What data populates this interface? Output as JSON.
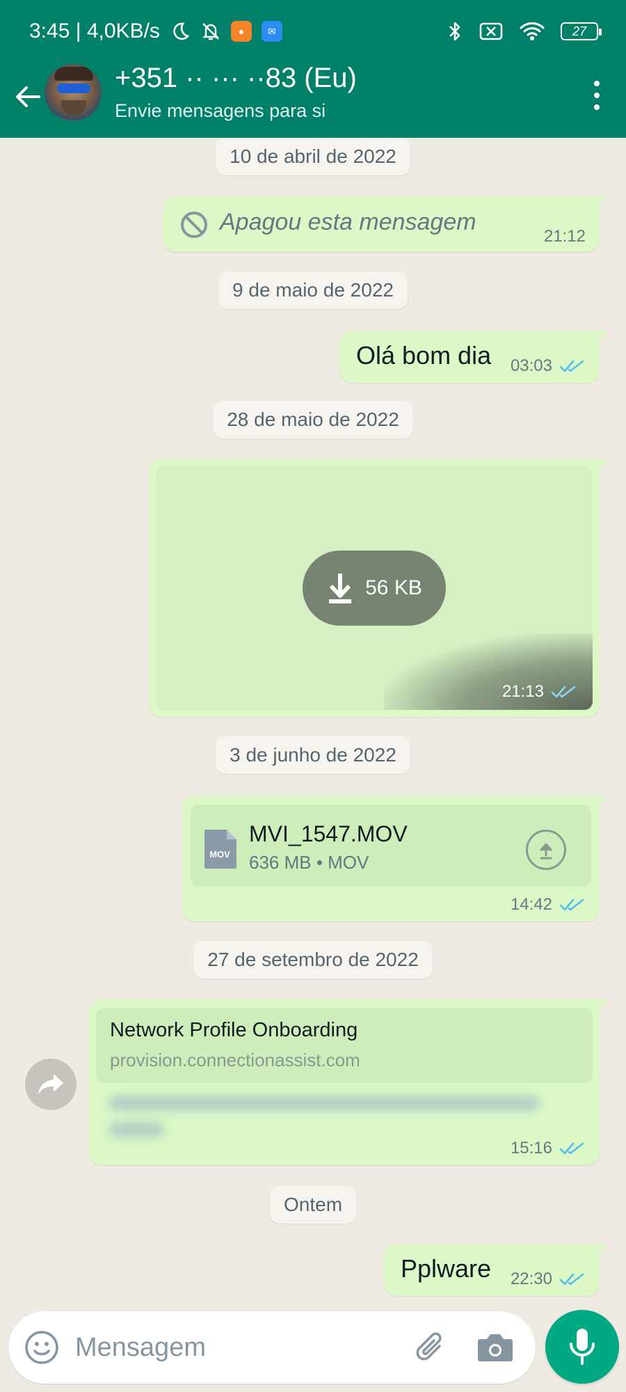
{
  "status_bar": {
    "time_speed": "3:45 | 4,0KB/s",
    "battery": "27",
    "app_badge_1_color": "#f5842b",
    "app_badge_2_color": "#2d8cf0"
  },
  "header": {
    "contact_name": "+351 ·· ··· ··83 (Eu)",
    "subtitle": "Envie mensagens para si",
    "brand_color": "#008069"
  },
  "messages": [
    {
      "type": "date",
      "label": "10 de abril de 2022"
    },
    {
      "type": "deleted",
      "text": "Apagou esta mensagem",
      "time": "21:12"
    },
    {
      "type": "date",
      "label": "9 de maio de 2022"
    },
    {
      "type": "text",
      "text": "Olá bom dia",
      "time": "03:03",
      "status": "read"
    },
    {
      "type": "date",
      "label": "28 de maio de 2022"
    },
    {
      "type": "image",
      "download_size": "56 KB",
      "time": "21:13",
      "status": "read"
    },
    {
      "type": "date",
      "label": "3 de junho de 2022"
    },
    {
      "type": "document",
      "filename": "MVI_1547.MOV",
      "info": "636 MB • MOV",
      "icon_label": "MOV",
      "time": "14:42",
      "status": "read"
    },
    {
      "type": "date",
      "label": "27 de setembro de 2022"
    },
    {
      "type": "link",
      "title": "Network Profile Onboarding",
      "url": "provision.connectionassist.com",
      "time": "15:16",
      "status": "read"
    },
    {
      "type": "date",
      "label": "Ontem"
    },
    {
      "type": "text",
      "text": "Pplware",
      "time": "22:30",
      "status": "read"
    }
  ],
  "composer": {
    "placeholder": "Mensagem"
  },
  "colors": {
    "chat_bg": "#efeae2",
    "bubble_out": "#dcf8c6",
    "read_ticks": "#53bdeb",
    "mic_button": "#00a884"
  }
}
